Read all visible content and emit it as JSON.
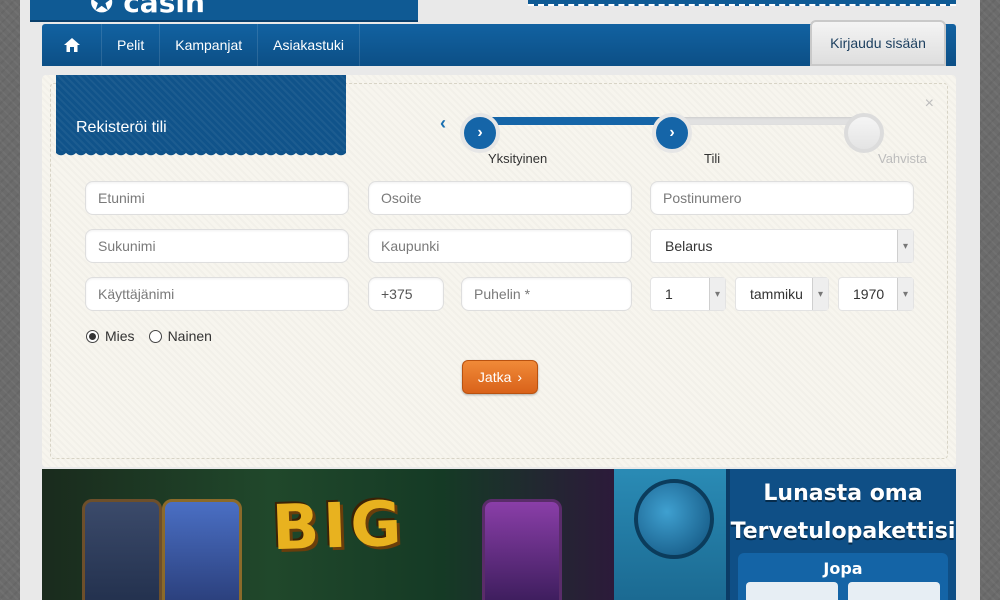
{
  "nav": {
    "items": [
      "Pelit",
      "Kampanjat",
      "Asiakastuki"
    ],
    "login_label": "Kirjaudu sisään"
  },
  "modal": {
    "title": "Rekisteröi tili",
    "close": "×",
    "steps": [
      {
        "label": "Yksityinen",
        "state": "done"
      },
      {
        "label": "Tili",
        "state": "active"
      },
      {
        "label": "Vahvista",
        "state": "pending"
      }
    ],
    "progress": 0.5,
    "fields": {
      "firstname": "Etunimi",
      "lastname": "Sukunimi",
      "username": "Käyttäjänimi",
      "address": "Osoite",
      "city": "Kaupunki",
      "phone_code": "+375",
      "phone": "Puhelin *",
      "postcode": "Postinumero"
    },
    "country": "Belarus",
    "dob": {
      "day": "1",
      "month": "tammiku",
      "year": "1970"
    },
    "gender": [
      {
        "label": "Mies",
        "checked": true
      },
      {
        "label": "Nainen",
        "checked": false
      }
    ],
    "continue_label": "Jatka"
  },
  "banner": {
    "game_text": "BIG",
    "promo_title_1": "Lunasta oma",
    "promo_title_2": "Tervetulopakettisi",
    "promo_sub": "Jopa"
  },
  "colors": {
    "brand_blue": "#1565a8",
    "accent_orange": "#e4742a"
  },
  "icons": [
    "home-icon",
    "chevron-left-icon",
    "chevron-right-icon",
    "close-icon",
    "dropdown-arrow-icon"
  ]
}
